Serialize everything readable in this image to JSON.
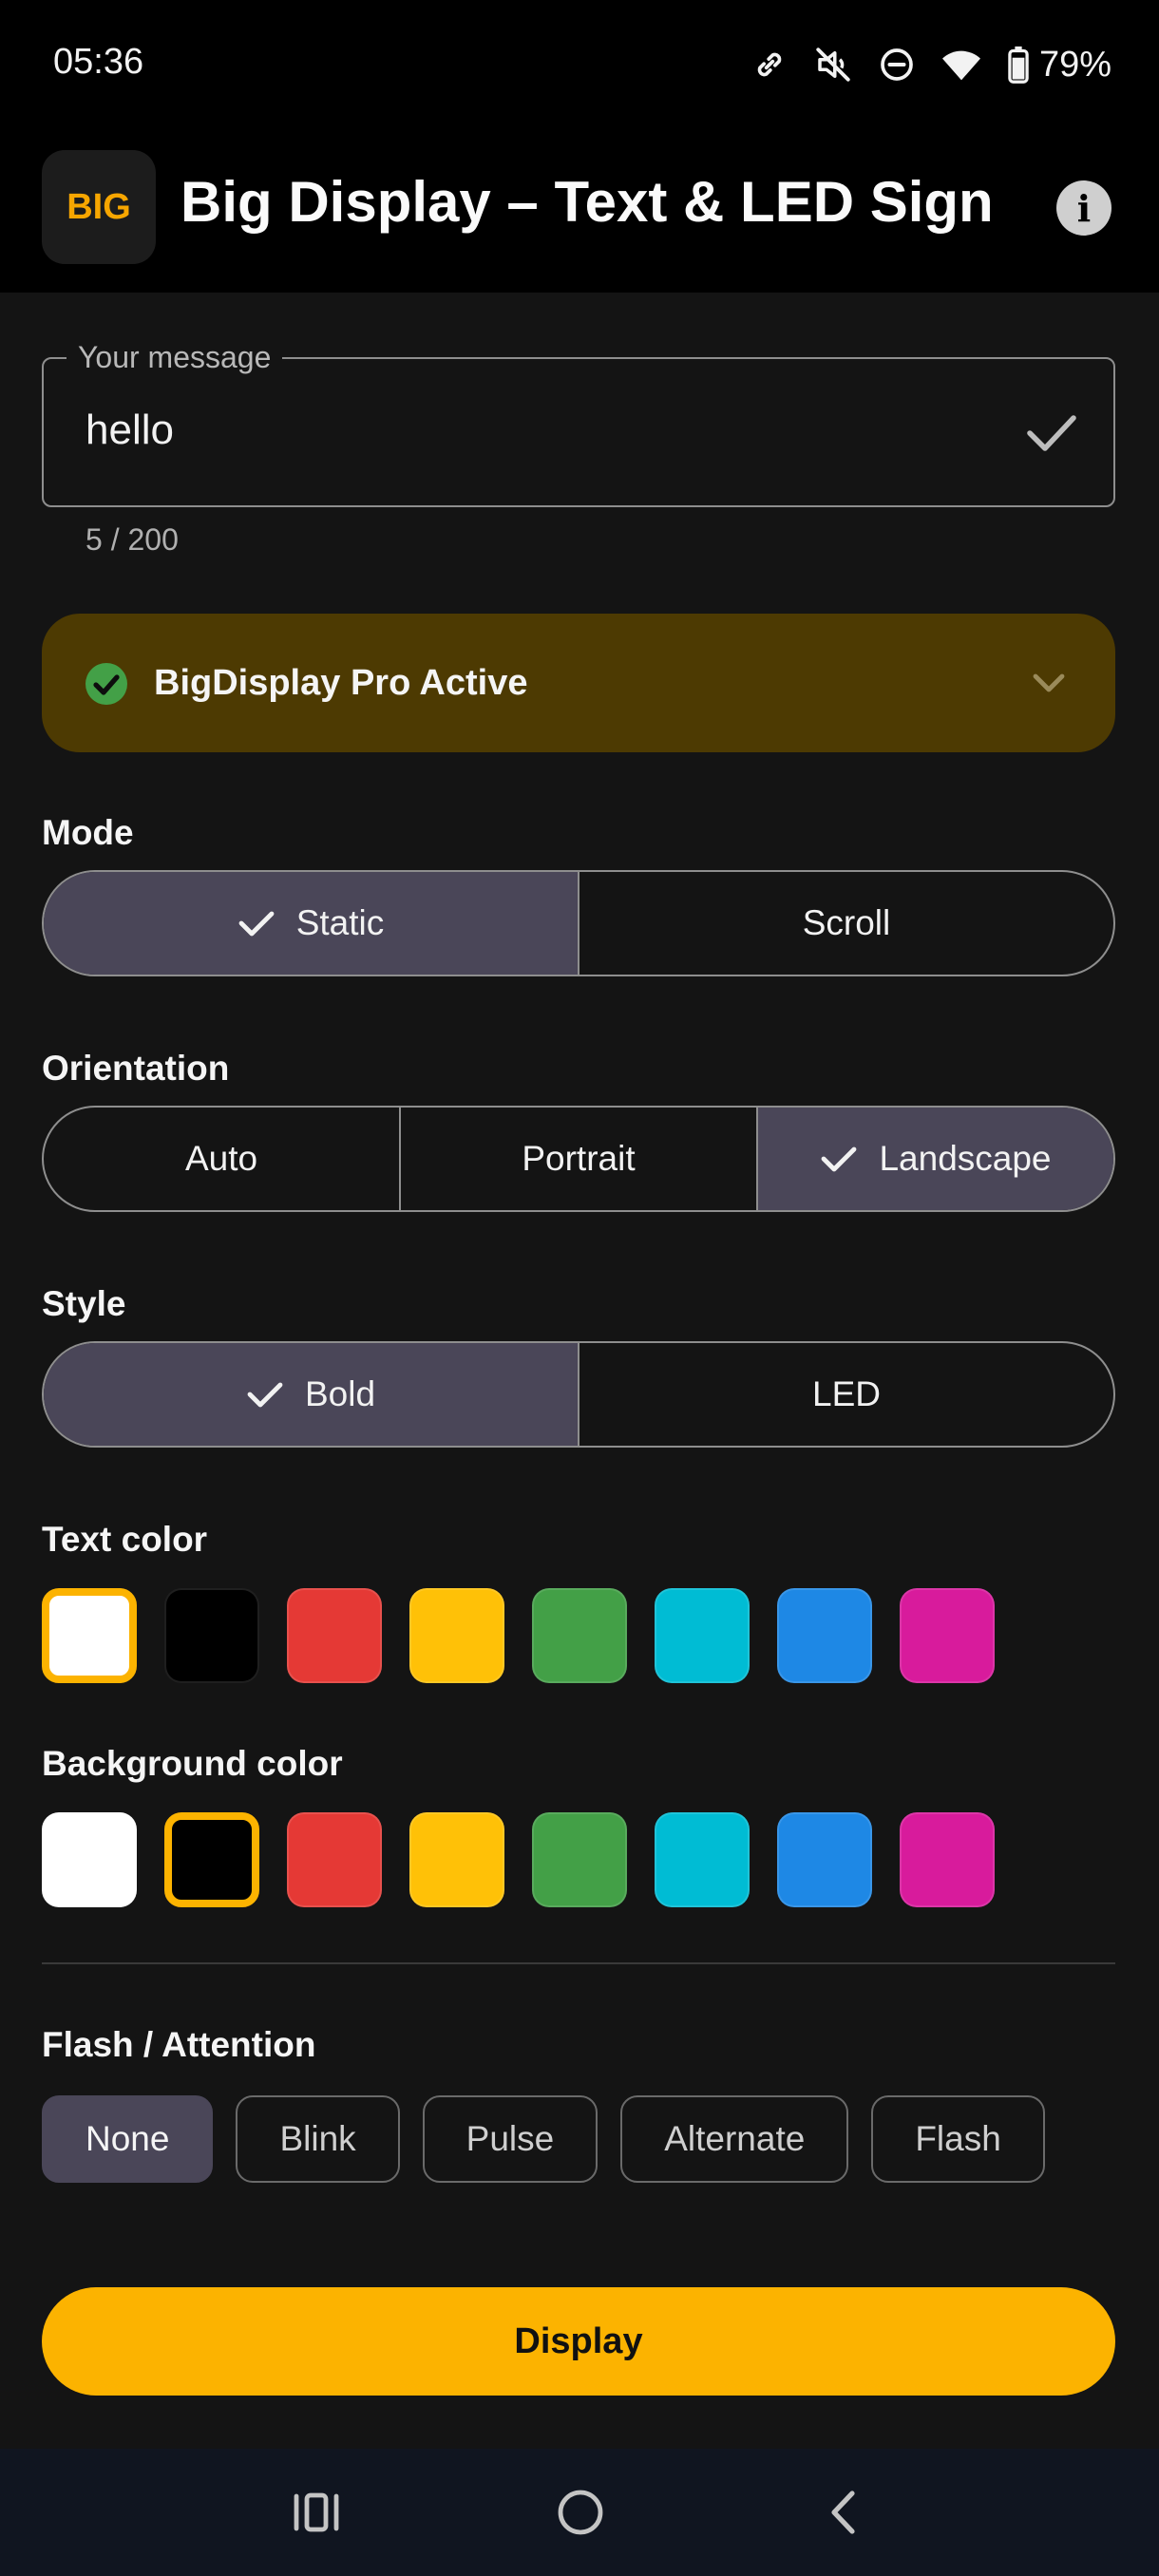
{
  "status_bar": {
    "time": "05:36",
    "battery": "79%",
    "icons": [
      "link-icon",
      "mute-icon",
      "dnd-icon",
      "wifi-icon",
      "battery-icon"
    ]
  },
  "app_bar": {
    "logo_text": "BIG",
    "title": "Big Display – Text & LED Sign",
    "info_icon": "i"
  },
  "message": {
    "label": "Your message",
    "value": "hello",
    "counter": "5 / 200"
  },
  "pro_banner": {
    "label": "BigDisplay Pro Active"
  },
  "mode": {
    "label": "Mode",
    "options": [
      "Static",
      "Scroll"
    ],
    "selected": "Static"
  },
  "orientation": {
    "label": "Orientation",
    "options": [
      "Auto",
      "Portrait",
      "Landscape"
    ],
    "selected": "Landscape"
  },
  "style": {
    "label": "Style",
    "options": [
      "Bold",
      "LED"
    ],
    "selected": "Bold"
  },
  "text_color": {
    "label": "Text color",
    "colors": [
      "#ffffff",
      "#000000",
      "#e53935",
      "#ffc107",
      "#43a047",
      "#00bcd4",
      "#1e88e5",
      "#d81b9c"
    ],
    "selected_index": 0
  },
  "background_color": {
    "label": "Background color",
    "colors": [
      "#ffffff",
      "#000000",
      "#e53935",
      "#ffc107",
      "#43a047",
      "#00bcd4",
      "#1e88e5",
      "#d81b9c"
    ],
    "selected_index": 1
  },
  "flash": {
    "label": "Flash / Attention",
    "options": [
      "None",
      "Blink",
      "Pulse",
      "Alternate",
      "Flash"
    ],
    "selected": "None"
  },
  "display_button": {
    "label": "Display"
  },
  "colors": {
    "accent": "#fcb300",
    "selected_segment": "#4a4658",
    "pro_banner_bg": "#4d3a02",
    "pro_check": "#43a047"
  }
}
